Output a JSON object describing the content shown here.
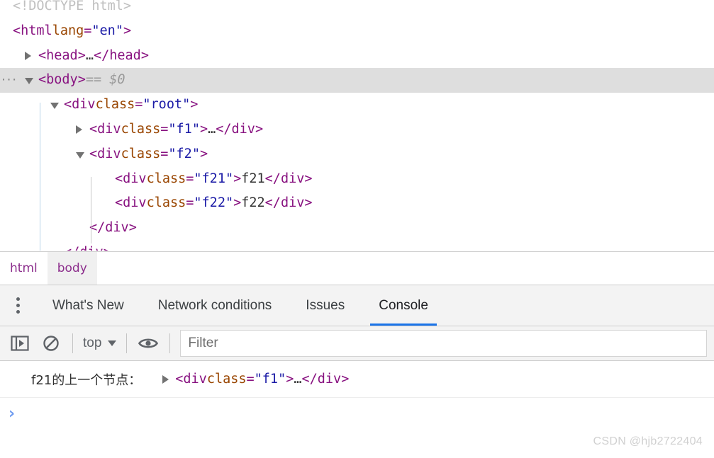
{
  "elements_panel": {
    "rows": [
      {
        "id": "doctype",
        "indent": 0,
        "twisty": "none",
        "selected": false,
        "clipped_top": true,
        "tokens": [
          {
            "cls": "t-doctype",
            "text": "<!DOCTYPE html>"
          }
        ]
      },
      {
        "id": "html-open",
        "indent": 0,
        "twisty": "none",
        "selected": false,
        "tokens": [
          {
            "cls": "t-bracket",
            "text": "<"
          },
          {
            "cls": "t-tag",
            "text": "html"
          },
          {
            "cls": "t-attr",
            "text": " lang"
          },
          {
            "cls": "t-bracket",
            "text": "="
          },
          {
            "cls": "t-val",
            "text": "\"en\""
          },
          {
            "cls": "t-bracket",
            "text": ">"
          }
        ]
      },
      {
        "id": "head",
        "indent": 1,
        "twisty": "closed",
        "selected": false,
        "tokens": [
          {
            "cls": "t-bracket",
            "text": "<"
          },
          {
            "cls": "t-tag",
            "text": "head"
          },
          {
            "cls": "t-bracket",
            "text": ">"
          },
          {
            "cls": "t-text",
            "text": "…"
          },
          {
            "cls": "t-bracket",
            "text": "</"
          },
          {
            "cls": "t-tag",
            "text": "head"
          },
          {
            "cls": "t-bracket",
            "text": ">"
          }
        ]
      },
      {
        "id": "body-open",
        "indent": 1,
        "twisty": "open",
        "selected": true,
        "badge": "···",
        "tokens": [
          {
            "cls": "t-bracket",
            "text": "<"
          },
          {
            "cls": "t-tag",
            "text": "body"
          },
          {
            "cls": "t-bracket",
            "text": ">"
          },
          {
            "cls": "t-gray",
            "text": "  ==  $0"
          }
        ]
      },
      {
        "id": "div-root",
        "indent": 2,
        "twisty": "open",
        "selected": false,
        "tokens": [
          {
            "cls": "t-bracket",
            "text": "<"
          },
          {
            "cls": "t-tag",
            "text": "div"
          },
          {
            "cls": "t-attr",
            "text": " class"
          },
          {
            "cls": "t-bracket",
            "text": "="
          },
          {
            "cls": "t-val",
            "text": "\"root\""
          },
          {
            "cls": "t-bracket",
            "text": ">"
          }
        ]
      },
      {
        "id": "div-f1",
        "indent": 3,
        "twisty": "closed",
        "selected": false,
        "tokens": [
          {
            "cls": "t-bracket",
            "text": "<"
          },
          {
            "cls": "t-tag",
            "text": "div"
          },
          {
            "cls": "t-attr",
            "text": " class"
          },
          {
            "cls": "t-bracket",
            "text": "="
          },
          {
            "cls": "t-val",
            "text": "\"f1\""
          },
          {
            "cls": "t-bracket",
            "text": ">"
          },
          {
            "cls": "t-text",
            "text": "…"
          },
          {
            "cls": "t-bracket",
            "text": "</"
          },
          {
            "cls": "t-tag",
            "text": "div"
          },
          {
            "cls": "t-bracket",
            "text": ">"
          }
        ]
      },
      {
        "id": "div-f2",
        "indent": 3,
        "twisty": "open",
        "selected": false,
        "tokens": [
          {
            "cls": "t-bracket",
            "text": "<"
          },
          {
            "cls": "t-tag",
            "text": "div"
          },
          {
            "cls": "t-attr",
            "text": " class"
          },
          {
            "cls": "t-bracket",
            "text": "="
          },
          {
            "cls": "t-val",
            "text": "\"f2\""
          },
          {
            "cls": "t-bracket",
            "text": ">"
          }
        ]
      },
      {
        "id": "div-f21",
        "indent": 4,
        "twisty": "none",
        "selected": false,
        "tokens": [
          {
            "cls": "t-bracket",
            "text": "<"
          },
          {
            "cls": "t-tag",
            "text": "div"
          },
          {
            "cls": "t-attr",
            "text": " class"
          },
          {
            "cls": "t-bracket",
            "text": "="
          },
          {
            "cls": "t-val",
            "text": "\"f21\""
          },
          {
            "cls": "t-bracket",
            "text": ">"
          },
          {
            "cls": "t-text",
            "text": "f21"
          },
          {
            "cls": "t-bracket",
            "text": "</"
          },
          {
            "cls": "t-tag",
            "text": "div"
          },
          {
            "cls": "t-bracket",
            "text": ">"
          }
        ]
      },
      {
        "id": "div-f22",
        "indent": 4,
        "twisty": "none",
        "selected": false,
        "tokens": [
          {
            "cls": "t-bracket",
            "text": "<"
          },
          {
            "cls": "t-tag",
            "text": "div"
          },
          {
            "cls": "t-attr",
            "text": " class"
          },
          {
            "cls": "t-bracket",
            "text": "="
          },
          {
            "cls": "t-val",
            "text": "\"f22\""
          },
          {
            "cls": "t-bracket",
            "text": ">"
          },
          {
            "cls": "t-text",
            "text": "f22"
          },
          {
            "cls": "t-bracket",
            "text": "</"
          },
          {
            "cls": "t-tag",
            "text": "div"
          },
          {
            "cls": "t-bracket",
            "text": ">"
          }
        ]
      },
      {
        "id": "div-f2-close",
        "indent": 3,
        "twisty": "none",
        "selected": false,
        "tokens": [
          {
            "cls": "t-bracket",
            "text": "</"
          },
          {
            "cls": "t-tag",
            "text": "div"
          },
          {
            "cls": "t-bracket",
            "text": ">"
          }
        ]
      },
      {
        "id": "div-root-close",
        "indent": 2,
        "twisty": "none",
        "selected": false,
        "clipped_bottom": true,
        "tokens": [
          {
            "cls": "t-bracket",
            "text": "</"
          },
          {
            "cls": "t-tag",
            "text": "div"
          },
          {
            "cls": "t-bracket",
            "text": ">"
          }
        ]
      }
    ]
  },
  "breadcrumb": {
    "items": [
      {
        "label": "html",
        "active": false
      },
      {
        "label": "body",
        "active": true
      }
    ]
  },
  "drawer": {
    "menu_icon": "more-vertical-icon",
    "tabs": [
      {
        "label": "What's New",
        "active": false
      },
      {
        "label": "Network conditions",
        "active": false
      },
      {
        "label": "Issues",
        "active": false
      },
      {
        "label": "Console",
        "active": true
      }
    ]
  },
  "console_toolbar": {
    "sidebar_toggle_icon": "console-sidebar-icon",
    "clear_icon": "clear-console-icon",
    "context_value": "top",
    "context_caret_icon": "chevron-down-icon",
    "live_expression_icon": "eye-icon",
    "filter_placeholder": "Filter",
    "filter_value": ""
  },
  "console_output": {
    "messages": [
      {
        "label": "f21的上一个节点：",
        "node_tokens": [
          {
            "cls": "t-bracket",
            "text": "<"
          },
          {
            "cls": "t-tag",
            "text": "div"
          },
          {
            "cls": "t-attr",
            "text": " class"
          },
          {
            "cls": "t-bracket",
            "text": "="
          },
          {
            "cls": "t-val",
            "text": "\"f1\""
          },
          {
            "cls": "t-bracket",
            "text": ">"
          },
          {
            "cls": "t-text",
            "text": "…"
          },
          {
            "cls": "t-bracket",
            "text": "</"
          },
          {
            "cls": "t-tag",
            "text": "div"
          },
          {
            "cls": "t-bracket",
            "text": ">"
          }
        ]
      }
    ],
    "prompt_symbol": "›",
    "prompt_value": ""
  },
  "watermark": {
    "text": "CSDN @hjb2722404"
  },
  "colors": {
    "tag": "#881280",
    "attr_name": "#994500",
    "attr_value": "#1a1aa6",
    "selected_row_bg": "#dedede",
    "active_tab_underline": "#1a73e8",
    "prompt_chevron": "#6f9cf0",
    "guide_line": "#b8d3e8"
  }
}
